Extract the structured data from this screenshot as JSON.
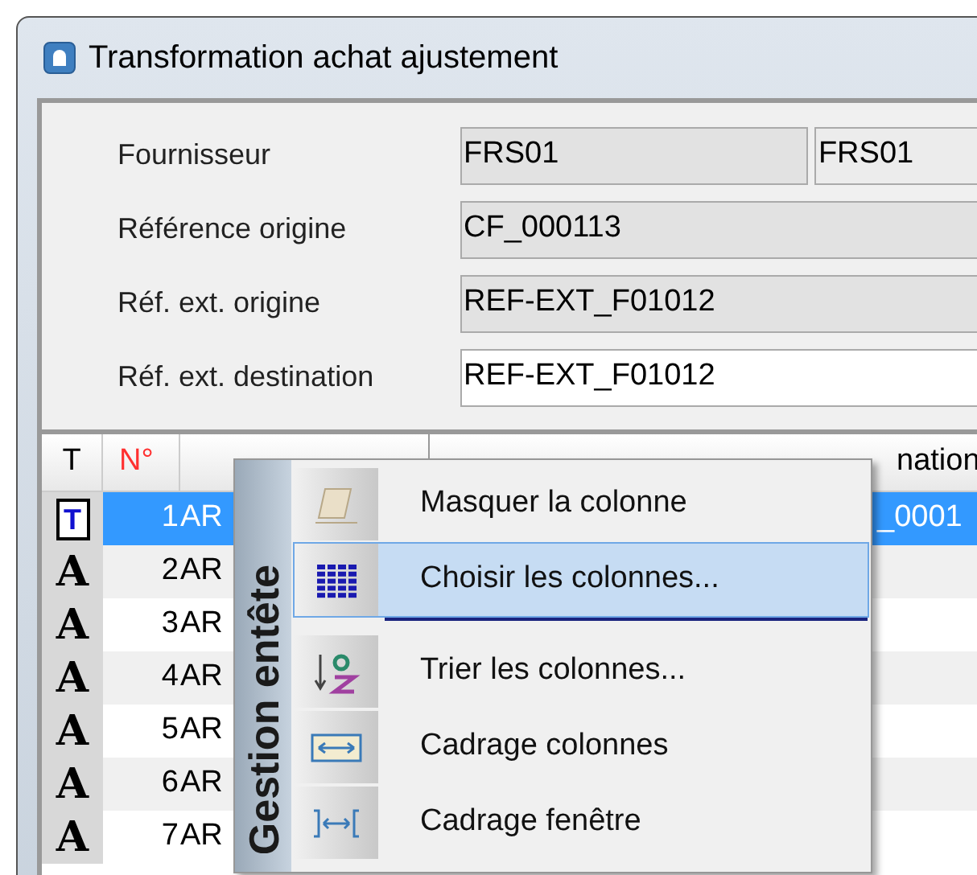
{
  "window": {
    "title": "Transformation achat ajustement"
  },
  "form": [
    {
      "label": "Fournisseur",
      "value": "FRS01",
      "value_2": "FRS01",
      "editable": false
    },
    {
      "label": "Référence origine",
      "value": "CF_000113",
      "editable": false
    },
    {
      "label": "Réf. ext. origine",
      "value": "REF-EXT_F01012",
      "editable": false
    },
    {
      "label": "Réf. ext. destination",
      "value": "REF-EXT_F01012",
      "editable": true
    }
  ],
  "grid": {
    "columns": [
      {
        "label": "T",
        "required": false
      },
      {
        "label": "N°",
        "required": true
      },
      {
        "label": "nation",
        "required": false
      }
    ],
    "rows": [
      {
        "type_glyph": "T",
        "kind": "title",
        "number": "1",
        "code": "AR",
        "destination": "_0001",
        "selected": true
      },
      {
        "type_glyph": "A",
        "kind": "article",
        "number": "2",
        "code": "AR",
        "selected": false
      },
      {
        "type_glyph": "A",
        "kind": "article",
        "number": "3",
        "code": "AR",
        "selected": false
      },
      {
        "type_glyph": "A",
        "kind": "article",
        "number": "4",
        "code": "AR",
        "selected": false
      },
      {
        "type_glyph": "A",
        "kind": "article",
        "number": "5",
        "code": "AR",
        "selected": false
      },
      {
        "type_glyph": "A",
        "kind": "article",
        "number": "6",
        "code": "AR",
        "selected": false
      },
      {
        "type_glyph": "A",
        "kind": "article",
        "number": "7",
        "code": "AR",
        "selected": false
      }
    ]
  },
  "context_menu": {
    "title": "Gestion entête",
    "items": [
      {
        "kind": "hide",
        "label": "Masquer la colonne",
        "selected": false,
        "separator_after": false
      },
      {
        "kind": "choose",
        "label": "Choisir les colonnes...",
        "selected": true,
        "separator_after": true
      },
      {
        "kind": "sort",
        "label": "Trier les colonnes...",
        "selected": false,
        "separator_after": false
      },
      {
        "kind": "fit-columns",
        "label": "Cadrage colonnes",
        "selected": false,
        "separator_after": false
      },
      {
        "kind": "fit-window",
        "label": "Cadrage fenêtre",
        "selected": false,
        "separator_after": false
      }
    ]
  }
}
